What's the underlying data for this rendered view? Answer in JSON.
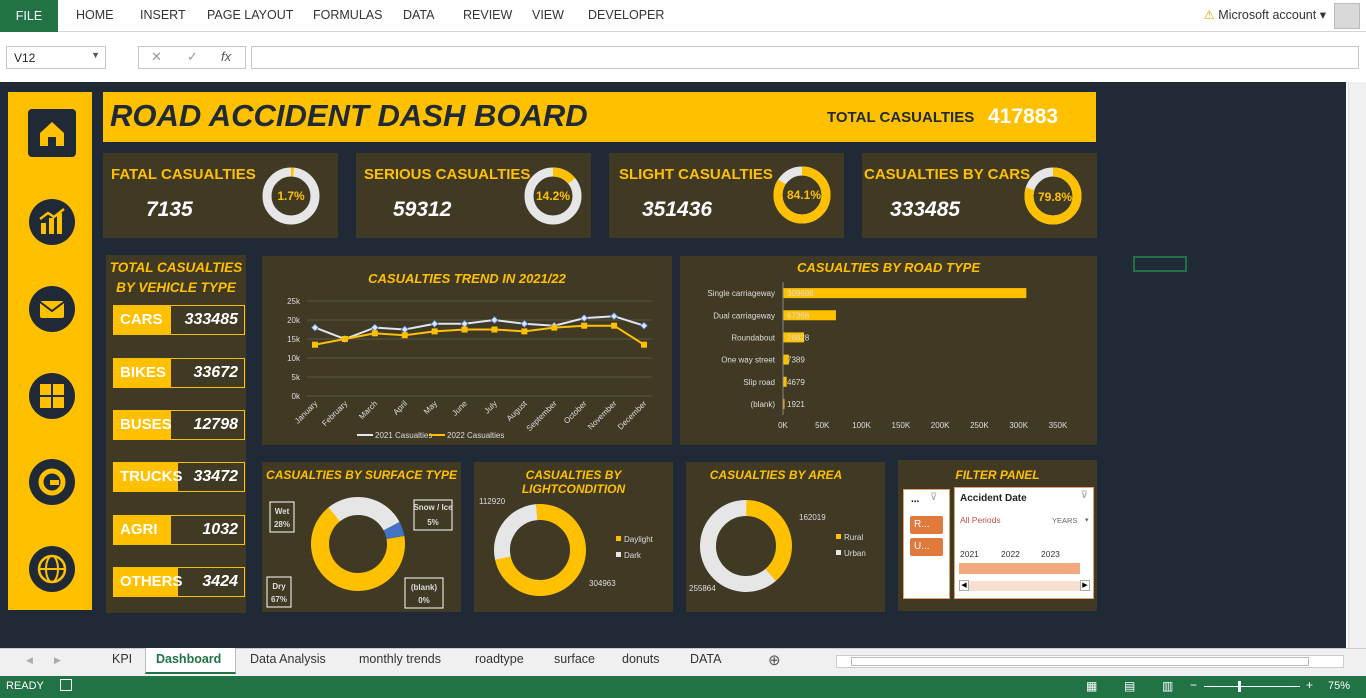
{
  "ribbon": {
    "file": "FILE",
    "tabs": [
      "HOME",
      "INSERT",
      "PAGE LAYOUT",
      "FORMULAS",
      "DATA",
      "REVIEW",
      "VIEW",
      "DEVELOPER"
    ],
    "account": "Microsoft account"
  },
  "formula_bar": {
    "name_box": "V12",
    "fx": "fx",
    "value": ""
  },
  "dashboard": {
    "title": "ROAD ACCIDENT DASH BOARD",
    "total_label": "TOTAL CASUALTIES",
    "total_value": "417883",
    "kpis": [
      {
        "label": "FATAL CASUALTIES",
        "value": "7135",
        "pct": "1.7%",
        "fraction": 0.017
      },
      {
        "label": "SERIOUS CASUALTIES",
        "value": "59312",
        "pct": "14.2%",
        "fraction": 0.142
      },
      {
        "label": "SLIGHT CASUALTIES",
        "value": "351436",
        "pct": "84.1%",
        "fraction": 0.841
      },
      {
        "label": "CASUALTIES BY CARS",
        "value": "333485",
        "pct": "79.8%",
        "fraction": 0.798
      }
    ],
    "vehicle": {
      "title1": "TOTAL CASUALTIES",
      "title2": "BY VEHICLE TYPE",
      "rows": [
        {
          "name": "CARS",
          "value": "333485"
        },
        {
          "name": "BIKES",
          "value": "33672"
        },
        {
          "name": "BUSES",
          "value": "12798"
        },
        {
          "name": "TRUCKS",
          "value": "33472"
        },
        {
          "name": "AGRI",
          "value": "1032"
        },
        {
          "name": "OTHERS",
          "value": "3424"
        }
      ]
    },
    "filter": {
      "title": "FILTER PANEL",
      "slicer_title": "...",
      "items": [
        "R...",
        "U..."
      ],
      "timeline_title": "Accident Date",
      "periods": "All Periods",
      "unit": "YEARS",
      "years": [
        "2021",
        "2022",
        "2023"
      ]
    }
  },
  "chart_data": [
    {
      "type": "line",
      "title": "CASUALTIES TREND IN 2021/22",
      "categories": [
        "January",
        "February",
        "March",
        "April",
        "May",
        "June",
        "July",
        "August",
        "September",
        "October",
        "November",
        "December"
      ],
      "yticks": [
        "0k",
        "5k",
        "10k",
        "15k",
        "20k",
        "25k"
      ],
      "ylim": [
        0,
        25000
      ],
      "series": [
        {
          "name": "2021 Casualties",
          "color": "#dfe6f2",
          "values": [
            18000,
            15000,
            18000,
            17500,
            19000,
            19000,
            20000,
            19000,
            18500,
            20500,
            21000,
            18500
          ]
        },
        {
          "name": "2022 Casualties",
          "color": "#ffc000",
          "values": [
            13500,
            15000,
            16500,
            16000,
            17000,
            17500,
            17500,
            17000,
            18000,
            18500,
            18500,
            13500
          ]
        }
      ]
    },
    {
      "type": "bar",
      "title": "CASUALTIES BY ROAD TYPE",
      "categories": [
        "Single carriageway",
        "Dual carriageway",
        "Roundabout",
        "One way street",
        "Slip road",
        "(blank)"
      ],
      "values": [
        309698,
        67368,
        26828,
        7389,
        4679,
        1921
      ],
      "labels": [
        "309698",
        "67368",
        "26828",
        "7389",
        "4679",
        "1921"
      ],
      "xticks": [
        "0K",
        "50K",
        "100K",
        "150K",
        "200K",
        "250K",
        "300K",
        "350K"
      ],
      "xlim": [
        0,
        350000
      ]
    },
    {
      "type": "pie",
      "title": "CASUALTIES BY SURFACE TYPE",
      "labels": [
        "Dry 67%",
        "Wet 28%",
        "Snow / Ice 5%",
        "(blank) 0%"
      ],
      "values": [
        67,
        28,
        5,
        0
      ]
    },
    {
      "type": "pie",
      "title": "CASUALTIES BY LIGHTCONDITION",
      "labels": [
        "Daylight",
        "Dark"
      ],
      "values": [
        304963,
        112920
      ]
    },
    {
      "type": "pie",
      "title": "CASUALTIES BY AREA",
      "labels": [
        "Rural",
        "Urban"
      ],
      "values": [
        162019,
        255864
      ]
    }
  ],
  "sheet_tabs": [
    "KPI",
    "Dashboard",
    "Data Analysis",
    "monthly trends",
    "roadtype",
    "surface",
    "donuts",
    "DATA"
  ],
  "status": {
    "ready": "READY",
    "zoom": "75%"
  }
}
